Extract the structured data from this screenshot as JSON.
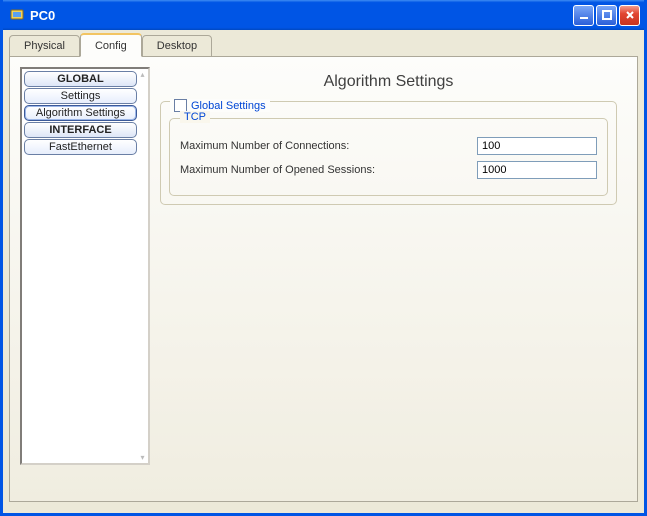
{
  "window": {
    "title": "PC0"
  },
  "tabs": [
    {
      "label": "Physical",
      "active": false
    },
    {
      "label": "Config",
      "active": true
    },
    {
      "label": "Desktop",
      "active": false
    }
  ],
  "sidebar": {
    "items": [
      {
        "label": "GLOBAL",
        "kind": "header"
      },
      {
        "label": "Settings",
        "kind": "item"
      },
      {
        "label": "Algorithm Settings",
        "kind": "item",
        "selected": true
      },
      {
        "label": "INTERFACE",
        "kind": "header"
      },
      {
        "label": "FastEthernet",
        "kind": "item"
      }
    ]
  },
  "page": {
    "title": "Algorithm Settings",
    "global_settings_label": "Global Settings",
    "global_settings_checked": false,
    "tcp": {
      "title": "TCP",
      "max_conn_label": "Maximum Number of Connections:",
      "max_conn_value": "100",
      "max_sess_label": "Maximum Number of Opened Sessions:",
      "max_sess_value": "1000"
    }
  }
}
